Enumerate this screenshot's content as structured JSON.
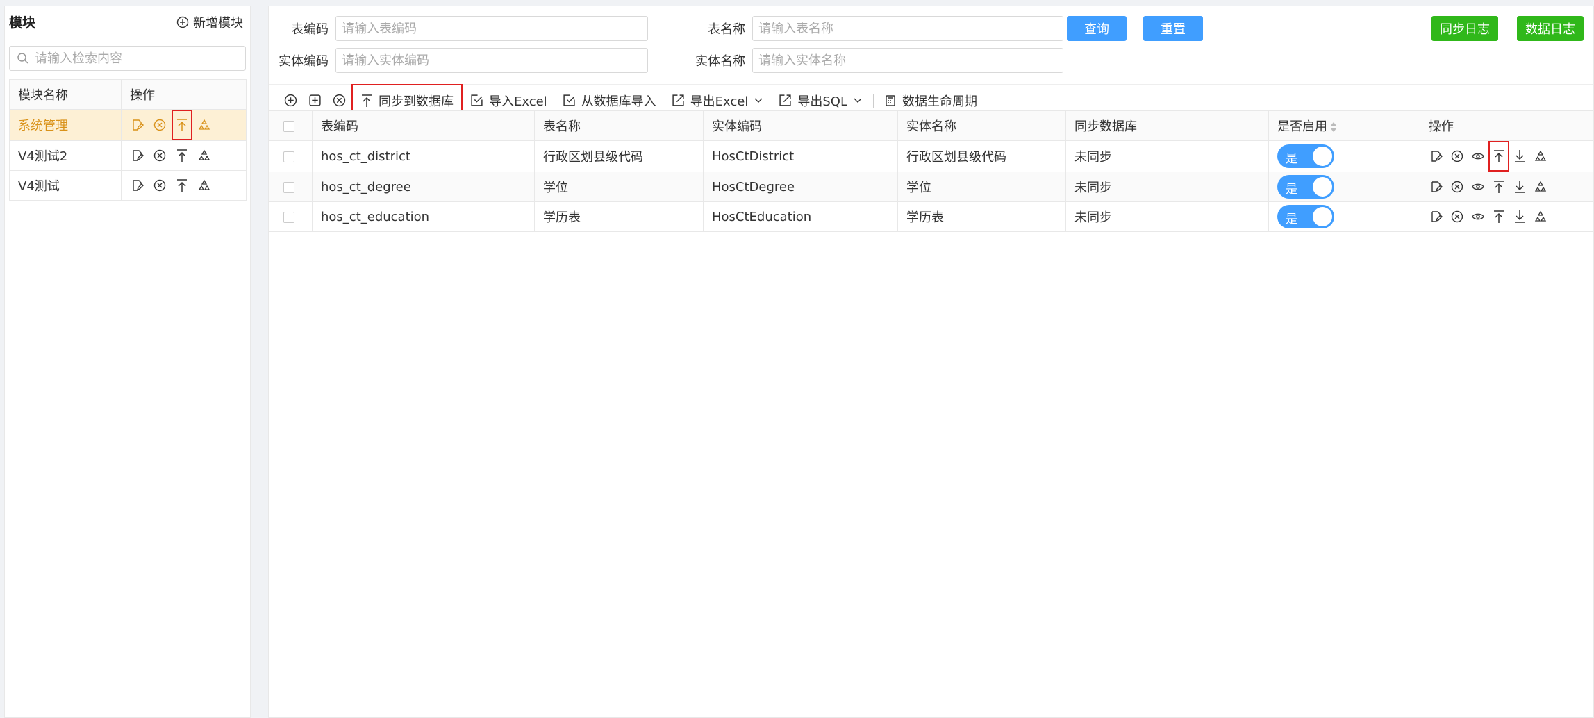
{
  "left": {
    "title": "模块",
    "add_label": "新增模块",
    "search_placeholder": "请输入检索内容",
    "columns": [
      "模块名称",
      "操作"
    ],
    "rows": [
      {
        "name": "系统管理"
      },
      {
        "name": "V4测试2"
      },
      {
        "name": "V4测试"
      }
    ]
  },
  "filter": {
    "table_code_label": "表编码",
    "table_code_placeholder": "请输入表编码",
    "table_name_label": "表名称",
    "table_name_placeholder": "请输入表名称",
    "entity_code_label": "实体编码",
    "entity_code_placeholder": "请输入实体编码",
    "entity_name_label": "实体名称",
    "entity_name_placeholder": "请输入实体名称",
    "query_label": "查询",
    "reset_label": "重置",
    "sync_log_label": "同步日志",
    "data_log_label": "数据日志"
  },
  "toolbar": {
    "sync_db": "同步到数据库",
    "import_excel": "导入Excel",
    "import_from_db": "从数据库导入",
    "export_excel": "导出Excel",
    "export_sql": "导出SQL",
    "lifecycle": "数据生命周期"
  },
  "table": {
    "columns": [
      "表编码",
      "表名称",
      "实体编码",
      "实体名称",
      "同步数据库",
      "是否启用",
      "操作"
    ],
    "rows": [
      {
        "code": "hos_ct_district",
        "name": "行政区划县级代码",
        "entity_code": "HosCtDistrict",
        "entity_name": "行政区划县级代码",
        "sync": "未同步",
        "enabled": "是"
      },
      {
        "code": "hos_ct_degree",
        "name": "学位",
        "entity_code": "HosCtDegree",
        "entity_name": "学位",
        "sync": "未同步",
        "enabled": "是"
      },
      {
        "code": "hos_ct_education",
        "name": "学历表",
        "entity_code": "HosCtEducation",
        "entity_name": "学历表",
        "sync": "未同步",
        "enabled": "是"
      }
    ]
  },
  "colors": {
    "accent": "#409eff",
    "green": "#30b81a",
    "selected_bg": "#fdf0d5",
    "selected_text": "#d9921a",
    "highlight": "#e02020"
  }
}
